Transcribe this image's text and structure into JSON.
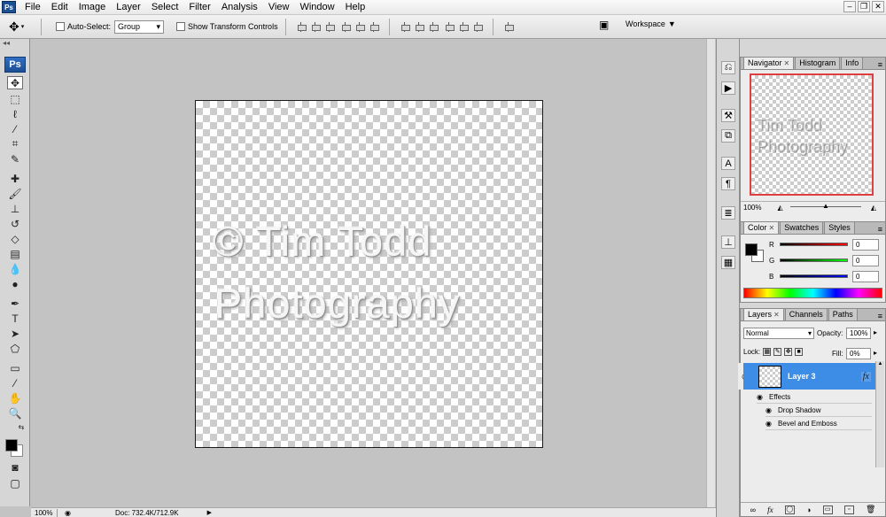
{
  "app": {
    "logo_text": "Ps",
    "small_logo_text": "Ps"
  },
  "menu": [
    "File",
    "Edit",
    "Image",
    "Layer",
    "Select",
    "Filter",
    "Analysis",
    "View",
    "Window",
    "Help"
  ],
  "window_controls": [
    "–",
    "❐",
    "✕"
  ],
  "options_bar": {
    "auto_select_label": "Auto-Select:",
    "auto_select_value": "Group",
    "show_transform_label": "Show Transform Controls",
    "workspace_label": "Workspace"
  },
  "document": {
    "watermark_line1": "© Tim Todd",
    "watermark_line2": "Photography"
  },
  "status": {
    "zoom": "100%",
    "doc_info": "Doc: 732.4K/712.9K"
  },
  "navigator": {
    "tabs": [
      "Navigator",
      "Histogram",
      "Info"
    ],
    "zoom": "100%",
    "thumb_line1": "Tim Todd",
    "thumb_line2": "Photography",
    "frame_color": "#e04040"
  },
  "color_panel": {
    "tabs": [
      "Color",
      "Swatches",
      "Styles"
    ],
    "r_label": "R",
    "g_label": "G",
    "b_label": "B",
    "r_value": "0",
    "g_value": "0",
    "b_value": "0",
    "foreground": "#000000",
    "background": "#ffffff"
  },
  "layers": {
    "tabs": [
      "Layers",
      "Channels",
      "Paths"
    ],
    "blend_mode": "Normal",
    "opacity_label": "Opacity:",
    "opacity_value": "100%",
    "lock_label": "Lock:",
    "fill_label": "Fill:",
    "fill_value": "0%",
    "layer_name": "Layer 3",
    "fx_label": "fx",
    "effects_label": "Effects",
    "effects": [
      "Drop Shadow",
      "Bevel and Emboss"
    ],
    "selection_color": "#3d8ce5"
  }
}
